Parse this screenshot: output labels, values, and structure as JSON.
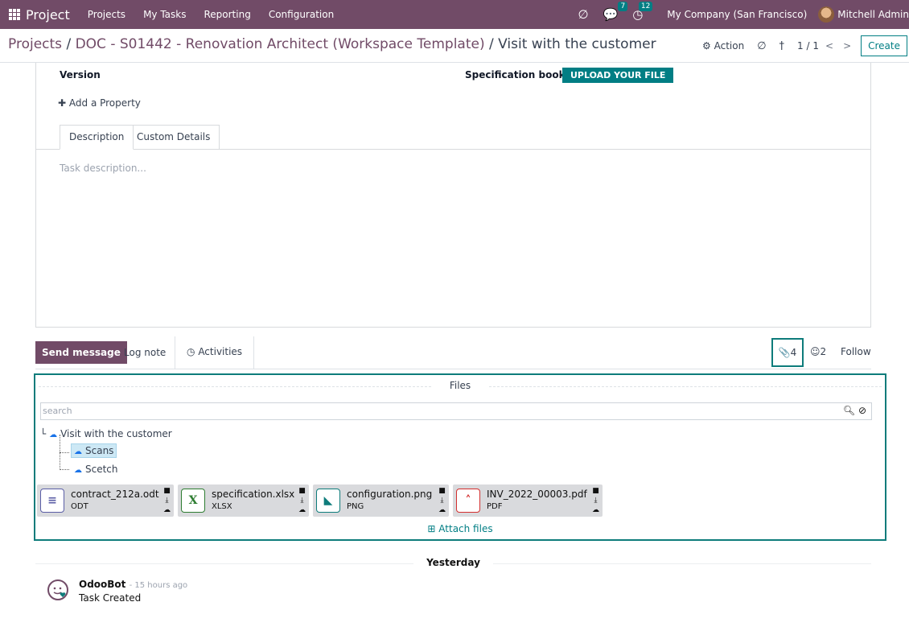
{
  "navbar": {
    "app_name": "Project",
    "menu": [
      "Projects",
      "My Tasks",
      "Reporting",
      "Configuration"
    ],
    "messages_count": "7",
    "activities_count": "12",
    "company": "My Company (San Francisco)",
    "user": "Mitchell Admin"
  },
  "control": {
    "breadcrumb_root": "Projects",
    "breadcrumb_project": "DOC - S01442 - Renovation Architect (Workspace Template)",
    "breadcrumb_current": "Visit with the customer",
    "action_label": "Action",
    "pager": "1 / 1",
    "create_label": "Create"
  },
  "form": {
    "version_label": "Version",
    "spec_label": "Specification books",
    "upload_label": "UPLOAD YOUR FILE",
    "add_property": "Add a Property",
    "tabs": [
      "Description",
      "Custom Details"
    ],
    "description_placeholder": "Task description..."
  },
  "chatter": {
    "send_message": "Send message",
    "log_note": "Log note",
    "activities": "Activities",
    "attachments_count": "4",
    "followers_count": "2",
    "follow": "Follow",
    "files_title": "Files",
    "search_placeholder": "search",
    "tree": {
      "root": "Visit with the customer",
      "children": [
        "Scans",
        "Scetch"
      ]
    },
    "attachments": [
      {
        "name": "contract_212a.odt",
        "ext": "ODT",
        "icon": "document-icon",
        "color": "#5b5ea6"
      },
      {
        "name": "specification.xlsx",
        "ext": "XLSX",
        "icon": "spreadsheet-icon",
        "color": "#2e7d32"
      },
      {
        "name": "configuration.png",
        "ext": "PNG",
        "icon": "image-icon",
        "color": "#0e7c7b"
      },
      {
        "name": "INV_2022_00003.pdf",
        "ext": "PDF",
        "icon": "pdf-icon",
        "color": "#d32f2f"
      }
    ],
    "attach_files": "Attach files",
    "day_separator": "Yesterday",
    "message": {
      "author": "OdooBot",
      "time": "- 15 hours ago",
      "body": "Task Created"
    }
  }
}
